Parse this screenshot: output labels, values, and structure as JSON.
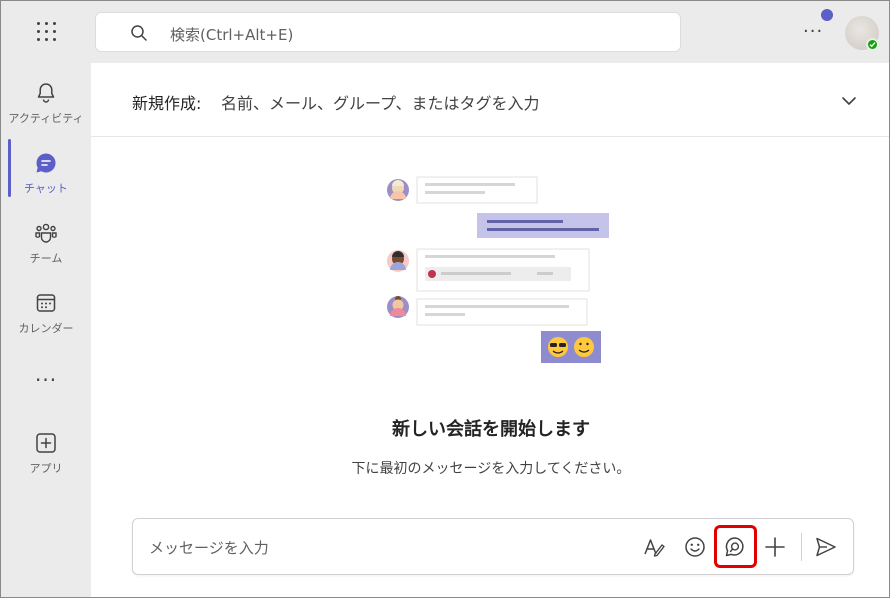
{
  "search": {
    "placeholder": "検索(Ctrl+Alt+E)"
  },
  "topbar": {
    "more_label": "···"
  },
  "rail": {
    "items": [
      {
        "label": "アクティビティ",
        "icon": "bell-icon"
      },
      {
        "label": "チャット",
        "icon": "chat-icon"
      },
      {
        "label": "チーム",
        "icon": "teams-icon"
      },
      {
        "label": "カレンダー",
        "icon": "calendar-icon"
      },
      {
        "label": "アプリ",
        "icon": "add-app-icon"
      }
    ],
    "more_label": "···"
  },
  "new_chat": {
    "to_label": "新規作成:",
    "to_placeholder": "名前、メール、グループ、またはタグを入力"
  },
  "empty_state": {
    "heading": "新しい会話を開始します",
    "subtext": "下に最初のメッセージを入力してください。"
  },
  "compose": {
    "placeholder": "メッセージを入力",
    "buttons": [
      "format-icon",
      "emoji-icon",
      "loop-icon",
      "plus-icon",
      "send-icon"
    ]
  },
  "colors": {
    "accent": "#5b5fc7",
    "highlight": "#e00000",
    "presence": "#13a10e"
  }
}
